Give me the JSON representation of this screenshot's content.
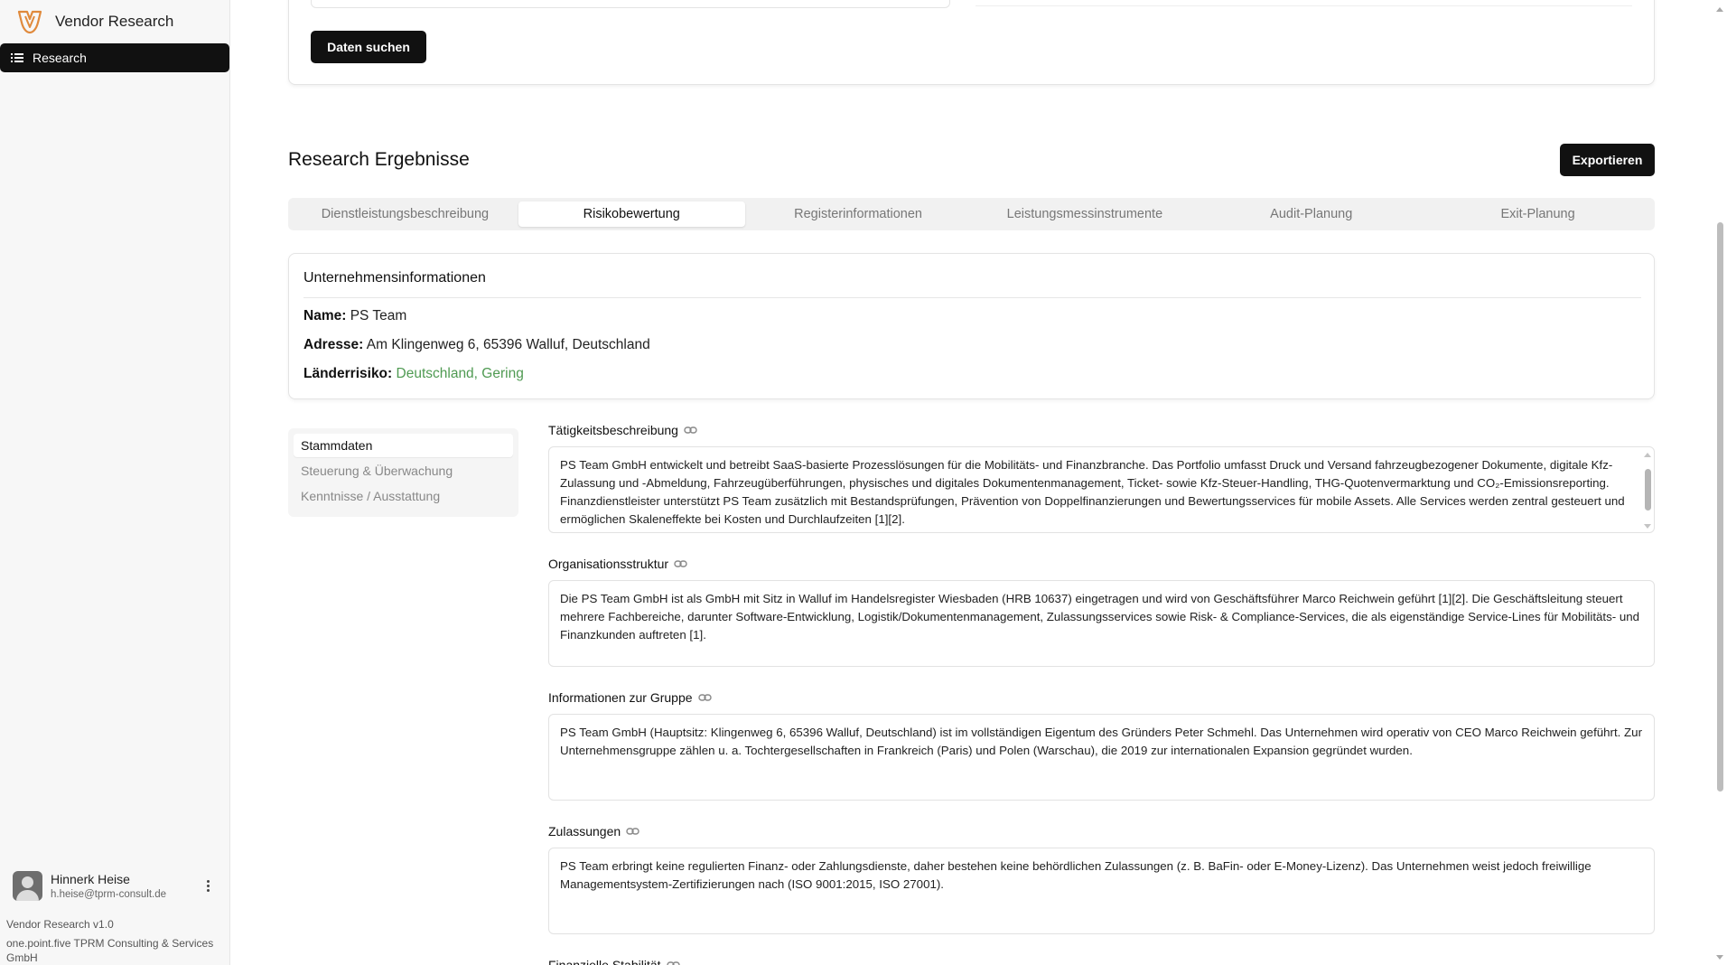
{
  "app": {
    "title": "Vendor Research"
  },
  "sidebar": {
    "items": [
      {
        "label": "Research",
        "icon": "list-icon"
      }
    ],
    "user": {
      "name": "Hinnerk Heise",
      "email": "h.heise@tprm-consult.de"
    },
    "version": "Vendor Research v1.0",
    "company": "one.point.five TPRM Consulting & Services GmbH"
  },
  "search": {
    "button_label": "Daten suchen"
  },
  "results": {
    "title": "Research Ergebnisse",
    "export_label": "Exportieren",
    "tabs": [
      {
        "label": "Dienstleistungsbeschreibung",
        "active": false
      },
      {
        "label": "Risikobewertung",
        "active": true
      },
      {
        "label": "Registerinformationen",
        "active": false
      },
      {
        "label": "Leistungsmessinstrumente",
        "active": false
      },
      {
        "label": "Audit-Planung",
        "active": false
      },
      {
        "label": "Exit-Planung",
        "active": false
      }
    ]
  },
  "company_info": {
    "title": "Unternehmensinformationen",
    "name_label": "Name:",
    "name": "PS Team",
    "address_label": "Adresse:",
    "address": "Am Klingenweg 6, 65396 Walluf, Deutschland",
    "country_risk_label": "Länderrisiko:",
    "country_risk": "Deutschland, Gering",
    "country_risk_color": "#4f9a52"
  },
  "subnav": {
    "items": [
      {
        "label": "Stammdaten",
        "active": true
      },
      {
        "label": "Steuerung & Überwachung",
        "active": false
      },
      {
        "label": "Kenntnisse / Ausstattung",
        "active": false
      }
    ]
  },
  "sections": [
    {
      "label": "Tätigkeitsbeschreibung",
      "text": "PS Team GmbH entwickelt und betreibt SaaS-basierte Prozesslösungen für die Mobilitäts- und Finanzbranche. Das Portfolio umfasst Druck und Versand fahrzeugbezogener Dokumente, digitale Kfz-Zulassung und -Abmeldung, Fahrzeugüberführungen, physisches und digitales Dokumentenmanagement, Ticket- sowie Kfz-Steuer-Handling, THG-Quotenvermarktung und CO₂-Emissionsreporting. Finanzdienstleister unterstützt PS Team zusätzlich mit Bestandsprüfungen, Prävention von Doppelfinanzierungen und Bewertungsservices für mobile Assets. Alle Services werden zentral gesteuert und ermöglichen Skaleneffekte bei Kosten und Durchlaufzeiten [1][2]."
    },
    {
      "label": "Organisationsstruktur",
      "text": "Die PS Team GmbH ist als GmbH mit Sitz in Walluf im Handelsregister Wiesbaden (HRB 10637) eingetragen und wird von Geschäftsführer Marco Reichwein geführt [1][2]. Die Geschäftsleitung steuert mehrere Fachbereiche, darunter Software-Entwicklung, Logistik/Dokumentenmanagement, Zulassungsservices sowie Risk- & Compliance-Services, die als eigenständige Service-Lines für Mobilitäts- und Finanzkunden auftreten [1]."
    },
    {
      "label": "Informationen zur Gruppe",
      "text": "PS Team GmbH (Hauptsitz: Klingenweg 6, 65396 Walluf, Deutschland) ist im vollständigen Eigentum des Gründers Peter Schmehl. Das Unternehmen wird operativ von CEO Marco Reichwein geführt. Zur Unternehmensgruppe zählen u. a. Tochtergesellschaften in Frankreich (Paris) und Polen (Warschau), die 2019 zur internationalen Expansion gegründet wurden."
    },
    {
      "label": "Zulassungen",
      "text": "PS Team erbringt keine regulierten Finanz- oder Zahlungsdienste, daher bestehen keine behördlichen Zulassungen (z. B. BaFin- oder E-Money-Lizenz). Das Unternehmen weist jedoch freiwillige Managementsystem-Zertifizierungen nach (ISO 9001:2015, ISO 27001)."
    },
    {
      "label": "Finanzielle Stabilität",
      "text": ""
    }
  ]
}
